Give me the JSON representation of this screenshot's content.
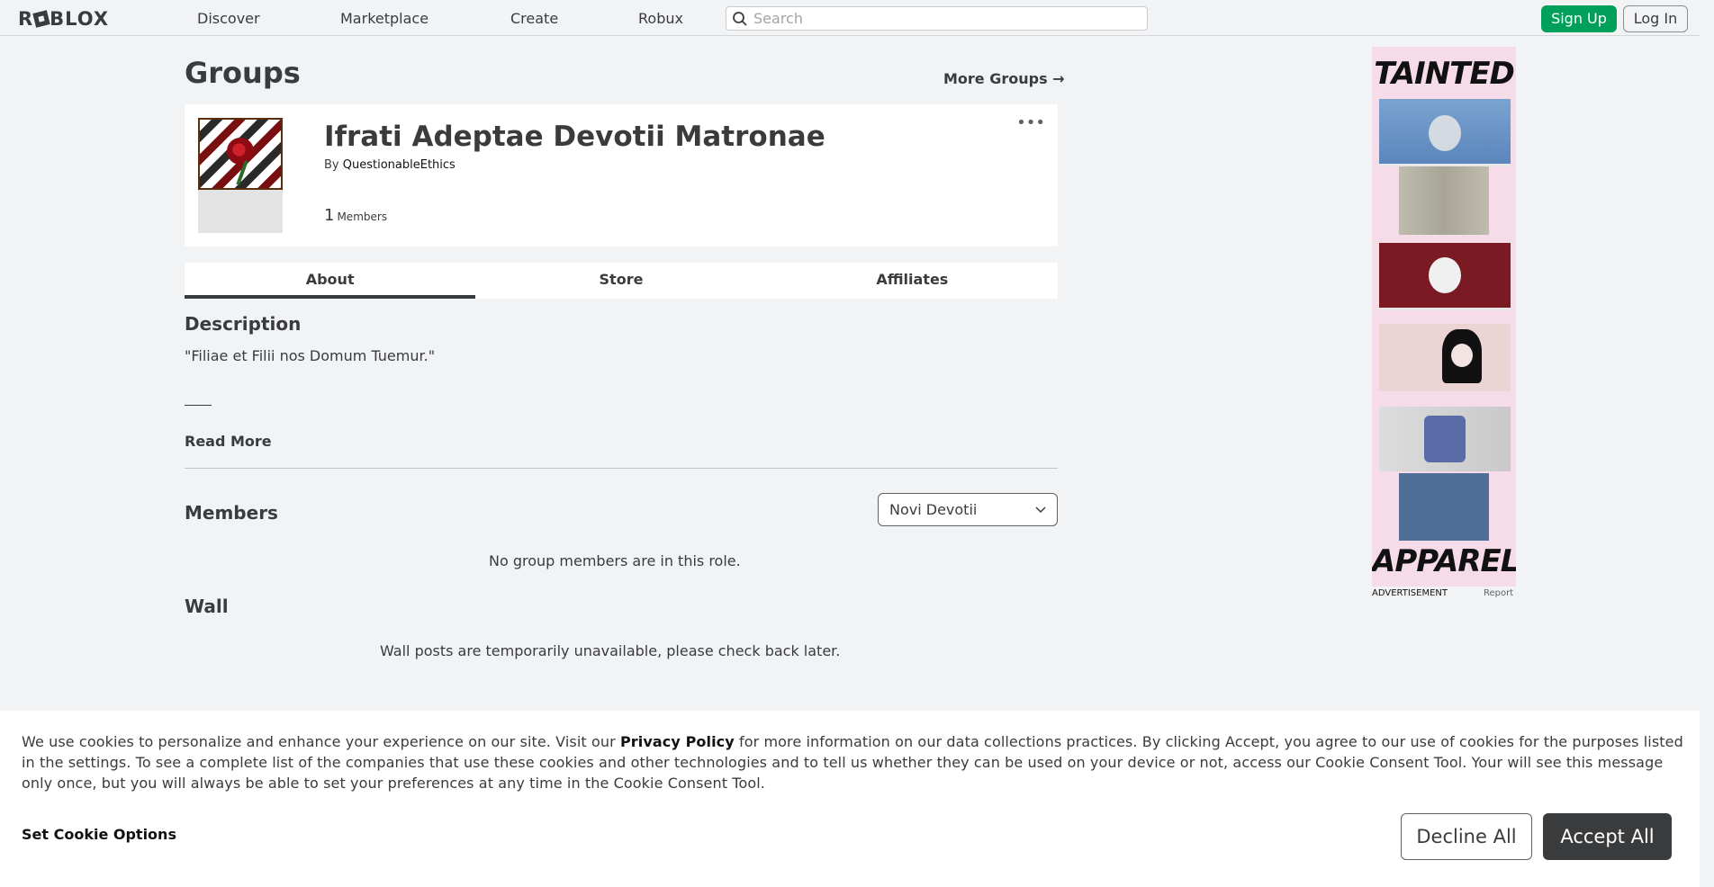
{
  "nav": {
    "logo": "ROBLOX",
    "links": [
      "Discover",
      "Marketplace",
      "Create",
      "Robux"
    ],
    "search_placeholder": "Search",
    "signup": "Sign Up",
    "login": "Log In"
  },
  "page": {
    "title": "Groups",
    "more_groups": "More Groups →"
  },
  "group": {
    "name": "Ifrati Adeptae Devotii Matronae",
    "by_label": "By",
    "owner": "QuestionableEthics",
    "member_count": "1",
    "members_label": "Members"
  },
  "tabs": [
    "About",
    "Store",
    "Affiliates"
  ],
  "about": {
    "description_title": "Description",
    "description_text": "\"Filiae et Filii nos Domum Tuemur.\"",
    "read_more": "Read More",
    "members_title": "Members",
    "role_selected": "Novi Devotii",
    "no_members": "No group members are in this role.",
    "wall_title": "Wall",
    "wall_unavailable": "Wall posts are temporarily unavailable, please check back later."
  },
  "ad": {
    "top_text": "TAINTED",
    "bottom_text": "APPAREL",
    "caption": "ADVERTISEMENT",
    "report": "Report"
  },
  "cookie": {
    "text_before": "We use cookies to personalize and enhance your experience on our site. Visit our ",
    "policy_link": "Privacy Policy",
    "text_after": " for more information on our data collections practices. By clicking Accept, you agree to our use of cookies for the purposes listed in the settings. To see a complete list of the companies that use these cookies and other technologies and to tell us whether they can be used on your device or not, access our Cookie Consent Tool. Your will see this message only once, but you will always be able to set your preferences at any time in the Cookie Consent Tool.",
    "set_options": "Set Cookie Options",
    "decline": "Decline All",
    "accept": "Accept All"
  },
  "colors": {
    "signup_green": "#00a05a",
    "accept_dark": "#393b3d",
    "background": "#f2f3f5"
  }
}
